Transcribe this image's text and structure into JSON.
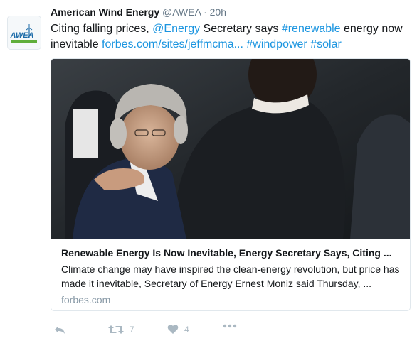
{
  "tweet": {
    "display_name": "American Wind Energy",
    "handle": "@AWEA",
    "separator": "·",
    "time": "20h",
    "text": {
      "part1": "Citing falling prices, ",
      "mention": "@Energy",
      "part2": " Secretary says ",
      "hashtag_renewable": "#renewable",
      "part3": " energy now inevitable ",
      "url": "forbes.com/sites/jeffmcma...",
      "hashtag_windpower": "#windpower",
      "hashtag_solar": "#solar"
    }
  },
  "avatar": {
    "label": "AWEA",
    "icon": "wind-turbine-icon"
  },
  "card": {
    "title": "Renewable Energy Is Now Inevitable, Energy Secretary Says, Citing ...",
    "description": "Climate change may have inspired the clean-energy revolution, but price has made it inevitable, Secretary of Energy Ernest Moniz said Thursday, ...",
    "domain": "forbes.com"
  },
  "actions": {
    "reply_icon": "reply-icon",
    "retweet_icon": "retweet-icon",
    "retweet_count": "7",
    "like_icon": "heart-icon",
    "like_count": "4",
    "more_icon": "more-icon"
  },
  "colors": {
    "link": "#1b95e0",
    "text": "#14171a",
    "secondary": "#657786",
    "action_gray": "#aab8c2",
    "domain_gray": "#8899a6"
  }
}
